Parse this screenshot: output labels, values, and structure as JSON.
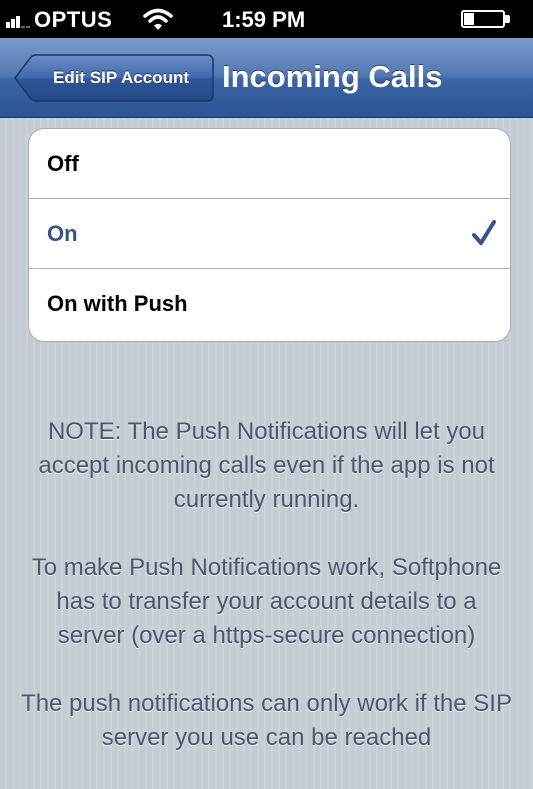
{
  "status_bar": {
    "carrier": "OPTUS",
    "time": "1:59 PM",
    "icons": [
      "signal-icon",
      "wifi-icon",
      "battery-icon"
    ]
  },
  "nav": {
    "back_label": "Edit SIP Account",
    "title": "Incoming Calls"
  },
  "options": [
    {
      "label": "Off",
      "selected": false
    },
    {
      "label": "On",
      "selected": true
    },
    {
      "label": "On with Push",
      "selected": false
    }
  ],
  "notes": [
    "NOTE: The Push Notifications will let you accept incoming calls even if the app is not currently running.",
    "To make Push Notifications work, Softphone has to transfer your account details to a server (over a https-secure connection)",
    "The push notifications can only work if the SIP server you use can be reached"
  ],
  "colors": {
    "nav_bar": "#3b64a6",
    "selected_text": "#385487",
    "background": "#c5ccd4",
    "note_text": "#4c566c"
  }
}
